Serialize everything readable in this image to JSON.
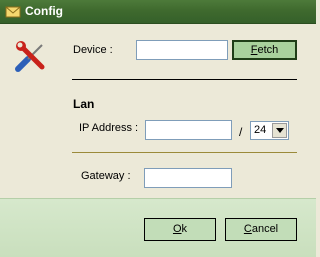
{
  "window": {
    "title": "Config",
    "title_icon": "envelope-icon"
  },
  "form": {
    "tools_icon": "screwdriver-wrench-icon",
    "device_label": "Device :",
    "device_value": "",
    "fetch_button": {
      "mnemonic": "F",
      "rest": "etch"
    },
    "lan_heading": "Lan",
    "ip_label": "IP Address :",
    "ip_value": "",
    "slash": "/",
    "prefix_value": "24",
    "gateway_label": "Gateway :",
    "gateway_value": ""
  },
  "footer": {
    "ok_button": {
      "mnemonic": "O",
      "rest": "k"
    },
    "cancel_button": {
      "mnemonic": "C",
      "rest": "ancel"
    }
  },
  "colors": {
    "titlebar": "#3f6a2e",
    "footer": "#c9dfbd",
    "fetch_button": "#a9d19d"
  }
}
